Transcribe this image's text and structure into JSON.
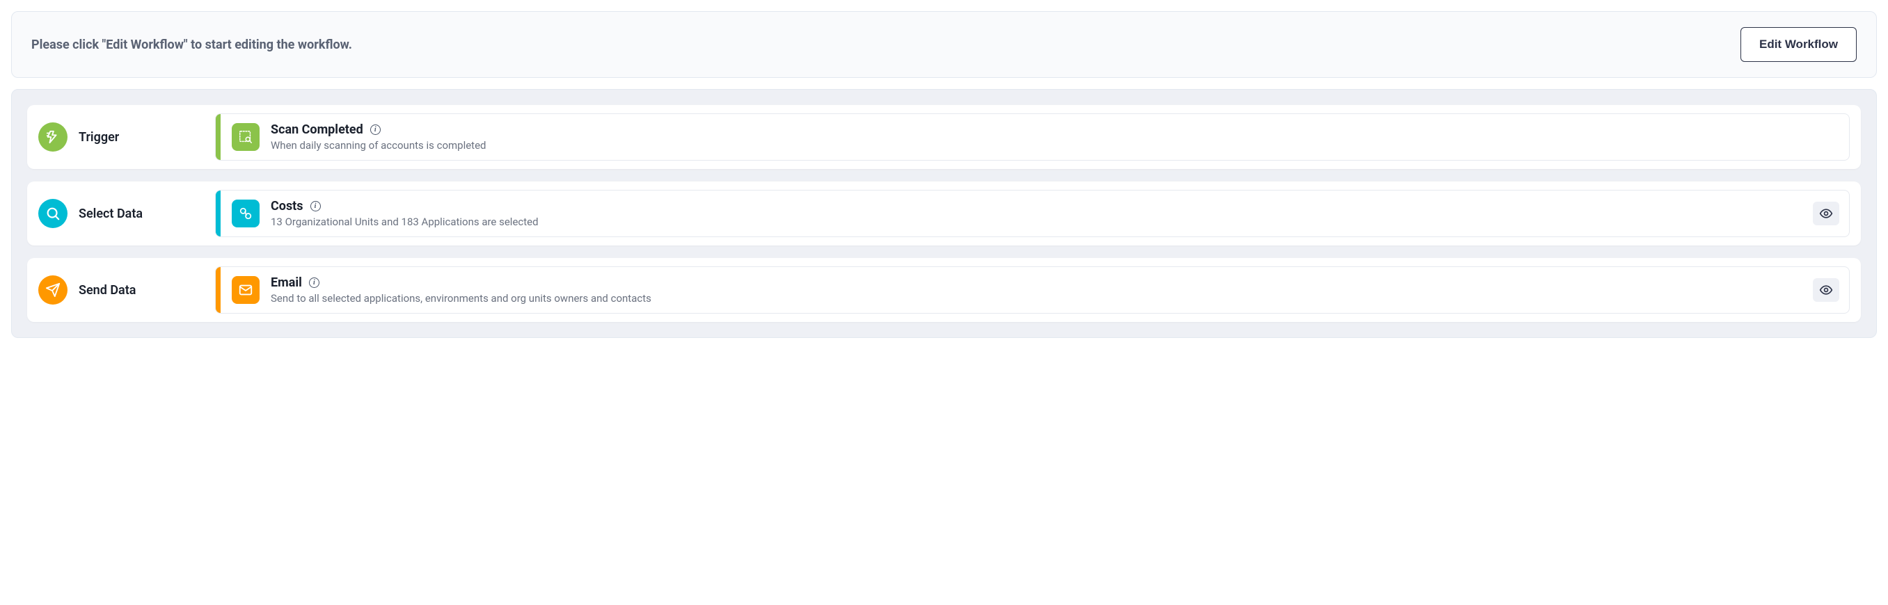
{
  "banner": {
    "text": "Please click \"Edit Workflow\" to start editing the workflow.",
    "button": "Edit Workflow"
  },
  "steps": [
    {
      "key": "trigger",
      "label": "Trigger",
      "color": "green",
      "card": {
        "title": "Scan Completed",
        "description": "When daily scanning of accounts is completed",
        "has_preview": false
      }
    },
    {
      "key": "select-data",
      "label": "Select Data",
      "color": "cyan",
      "card": {
        "title": "Costs",
        "description": "13 Organizational Units and 183 Applications are selected",
        "has_preview": true
      }
    },
    {
      "key": "send-data",
      "label": "Send Data",
      "color": "orange",
      "card": {
        "title": "Email",
        "description": "Send to all selected applications, environments and org units owners and contacts",
        "has_preview": true
      }
    }
  ]
}
